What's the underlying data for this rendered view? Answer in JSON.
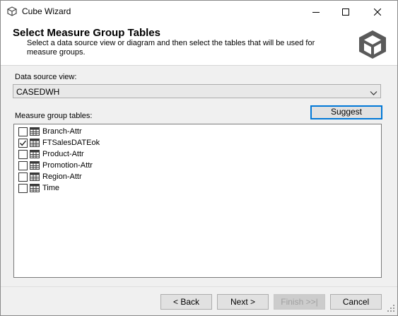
{
  "window": {
    "title": "Cube Wizard",
    "title_icon": "cube-icon",
    "controls": [
      "minimize-icon",
      "maximize-icon",
      "close-icon"
    ]
  },
  "header": {
    "title": "Select Measure Group Tables",
    "description": "Select a data source view or diagram and then select the tables that will be used for measure groups.",
    "logo_icon": "cube-logo-icon"
  },
  "data_source_view": {
    "label": "Data source view:",
    "selected": "CASEDWH"
  },
  "measure_group": {
    "label": "Measure group tables:",
    "suggest_label": "Suggest",
    "tables": [
      {
        "label": "Branch-Attr",
        "checked": false
      },
      {
        "label": "FTSalesDATEok",
        "checked": true
      },
      {
        "label": "Product-Attr",
        "checked": false
      },
      {
        "label": "Promotion-Attr",
        "checked": false
      },
      {
        "label": "Region-Attr",
        "checked": false
      },
      {
        "label": "Time",
        "checked": false
      }
    ]
  },
  "footer": {
    "back_label": "< Back",
    "next_label": "Next >",
    "finish_label": "Finish >>|",
    "cancel_label": "Cancel"
  },
  "colors": {
    "window_bg": "#f0f0f0",
    "default_button_border": "#0078d7",
    "header_bg": "#ffffff"
  }
}
